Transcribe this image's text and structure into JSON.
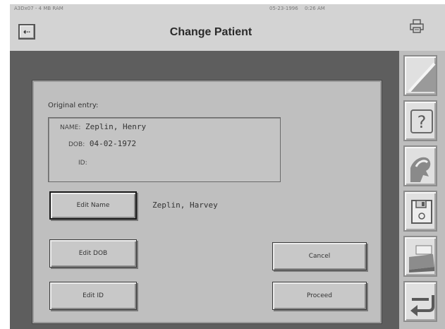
{
  "header": {
    "device_id": "A3Dx07 - 4 MB RAM",
    "date": "05-23-1996",
    "time": "0:26 AM",
    "back_label": "⇠",
    "title": "Change Patient"
  },
  "dialog": {
    "original_label": "Original entry:",
    "original": {
      "name_label": "NAME:",
      "name_value": "Zeplin, Henry",
      "dob_label": "DOB:",
      "dob_value": "04-02-1972",
      "id_label": "ID:",
      "id_value": ""
    },
    "new_name_value": "Zeplin, Harvey",
    "buttons": {
      "edit_name": "Edit Name",
      "edit_dob": "Edit DOB",
      "edit_id": "Edit ID",
      "cancel": "Cancel",
      "proceed": "Proceed"
    }
  },
  "toolbar": {
    "items": [
      {
        "icon": "pen-stroke-icon"
      },
      {
        "icon": "help-question-icon"
      },
      {
        "icon": "person-profile-icon"
      },
      {
        "icon": "floppy-disk-icon"
      },
      {
        "icon": "printer-icon"
      },
      {
        "icon": "return-arrow-icon"
      }
    ]
  },
  "colors": {
    "main_background": "#5e5e5e",
    "dialog_background": "#bfbfbf",
    "toolbar_background": "#bdbdbd"
  }
}
